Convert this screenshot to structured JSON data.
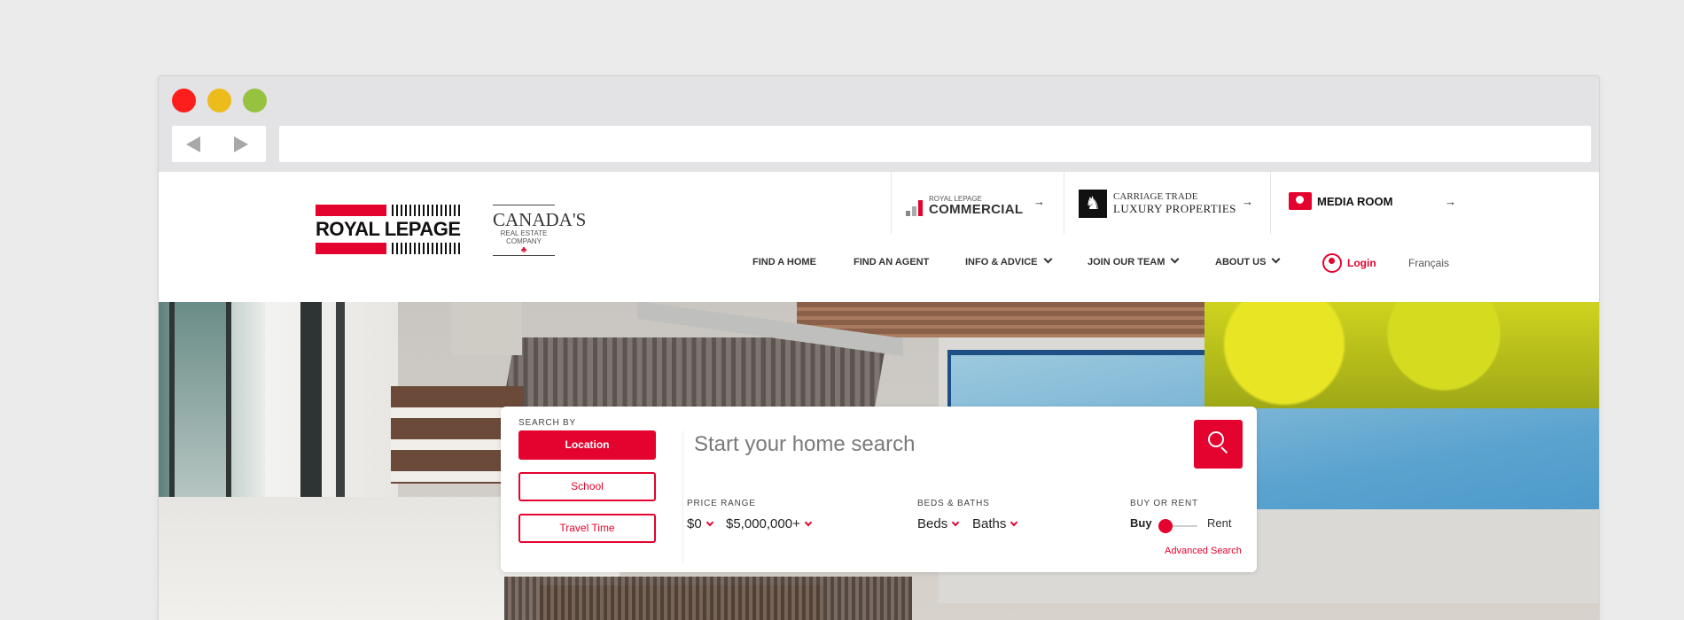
{
  "browser": {
    "url": ""
  },
  "header": {
    "logo_main": "ROYAL LEPAGE",
    "logo_sub_big": "CANADA'S",
    "logo_sub_small": "REAL ESTATE COMPANY",
    "partners": [
      {
        "small": "ROYAL LEPAGE",
        "big": "COMMERCIAL"
      },
      {
        "small": "CARRIAGE TRADE",
        "big": "LUXURY PROPERTIES"
      },
      {
        "big": "MEDIA ROOM"
      }
    ],
    "partner_arrow": "→",
    "nav": {
      "find_home": "FIND A HOME",
      "find_agent": "FIND AN AGENT",
      "info_advice": "INFO & ADVICE",
      "join_team": "JOIN OUR TEAM",
      "about_us": "ABOUT US",
      "login": "Login",
      "language": "Français"
    }
  },
  "search": {
    "search_by_label": "SEARCH BY",
    "modes": [
      "Location",
      "School",
      "Travel Time"
    ],
    "active_mode": "Location",
    "placeholder": "Start your home search",
    "price_label": "PRICE RANGE",
    "price_min": "$0",
    "price_max": "$5,000,000+",
    "beds_baths_label": "BEDS & BATHS",
    "beds": "Beds",
    "baths": "Baths",
    "buy_rent_label": "BUY OR RENT",
    "buy": "Buy",
    "rent": "Rent",
    "advanced": "Advanced Search"
  },
  "colors": {
    "brand_red": "#e4032e"
  }
}
